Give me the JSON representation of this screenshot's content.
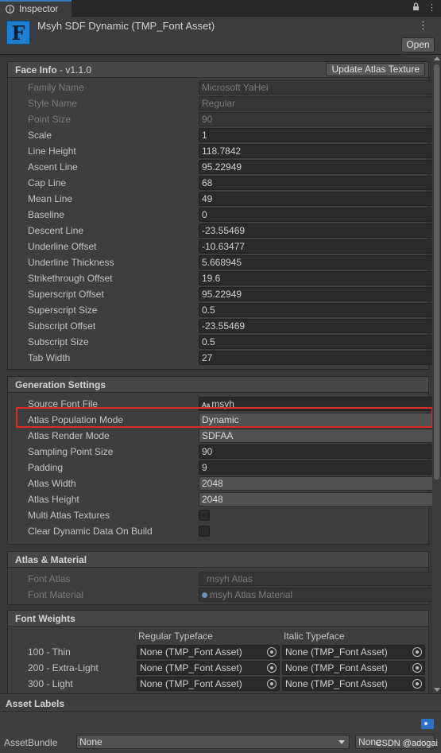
{
  "tab": {
    "label": "Inspector"
  },
  "header": {
    "title": "Msyh SDF Dynamic (TMP_Font Asset)",
    "icon_letter": "F",
    "open_label": "Open"
  },
  "face_info": {
    "title": "Face Info",
    "version": " - v1.1.0",
    "update_label": "Update Atlas Texture",
    "rows": [
      {
        "label": "Family Name",
        "value": "Microsoft YaHei",
        "disabled": true
      },
      {
        "label": "Style Name",
        "value": "Regular",
        "disabled": true
      },
      {
        "label": "Point Size",
        "value": "90",
        "disabled": true
      },
      {
        "label": "Scale",
        "value": "1"
      },
      {
        "label": "Line Height",
        "value": "118.7842"
      },
      {
        "label": "Ascent Line",
        "value": "95.22949"
      },
      {
        "label": "Cap Line",
        "value": "68"
      },
      {
        "label": "Mean Line",
        "value": "49"
      },
      {
        "label": "Baseline",
        "value": "0"
      },
      {
        "label": "Descent Line",
        "value": "-23.55469"
      },
      {
        "label": "Underline Offset",
        "value": "-10.63477"
      },
      {
        "label": "Underline Thickness",
        "value": "5.668945"
      },
      {
        "label": "Strikethrough Offset",
        "value": "19.6"
      },
      {
        "label": "Superscript Offset",
        "value": "95.22949"
      },
      {
        "label": "Superscript Size",
        "value": "0.5"
      },
      {
        "label": "Subscript Offset",
        "value": "-23.55469"
      },
      {
        "label": "Subscript Size",
        "value": "0.5"
      },
      {
        "label": "Tab Width",
        "value": "27"
      }
    ]
  },
  "generation": {
    "title": "Generation Settings",
    "source_font_label": "Source Font File",
    "source_font_value": "msyh",
    "source_font_icon": "Aa",
    "population_label": "Atlas Population Mode",
    "population_value": "Dynamic",
    "render_label": "Atlas Render Mode",
    "render_value": "SDFAA",
    "sampling_label": "Sampling Point Size",
    "sampling_value": "90",
    "padding_label": "Padding",
    "padding_value": "9",
    "width_label": "Atlas Width",
    "width_value": "2048",
    "height_label": "Atlas Height",
    "height_value": "2048",
    "multi_label": "Multi Atlas Textures",
    "clear_label": "Clear Dynamic Data On Build"
  },
  "atlas_material": {
    "title": "Atlas & Material",
    "font_atlas_label": "Font Atlas",
    "font_atlas_value": "msyh Atlas",
    "font_material_label": "Font Material",
    "font_material_value": "msyh Atlas Material"
  },
  "font_weights": {
    "title": "Font Weights",
    "col_regular": "Regular Typeface",
    "col_italic": "Italic Typeface",
    "rows": [
      {
        "label": "100 - Thin",
        "regular": "None (TMP_Font Asset)",
        "italic": "None (TMP_Font Asset)"
      },
      {
        "label": "200 - Extra-Light",
        "regular": "None (TMP_Font Asset)",
        "italic": "None (TMP_Font Asset)"
      },
      {
        "label": "300 - Light",
        "regular": "None (TMP_Font Asset)",
        "italic": "None (TMP_Font Asset)"
      }
    ]
  },
  "asset_labels": {
    "title": "Asset Labels",
    "bundle_label": "AssetBundle",
    "bundle_value": "None",
    "variant_value": "None",
    "watermark": "CSDN @adogai"
  },
  "colors": {
    "highlight": "#e02b2b",
    "accent": "#3a79bb",
    "icon_blue": "#1e7fd0"
  }
}
